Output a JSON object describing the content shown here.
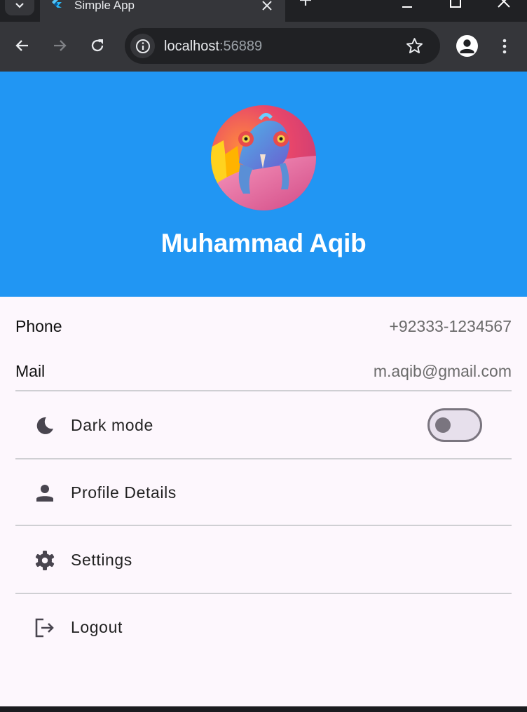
{
  "browser": {
    "tab_title": "Simple App",
    "url_host": "localhost",
    "url_port": ":56889"
  },
  "profile": {
    "name": "Muhammad Aqib"
  },
  "info": {
    "phone_label": "Phone",
    "phone_value": "+92333-1234567",
    "mail_label": "Mail",
    "mail_value": "m.aqib@gmail.com"
  },
  "menu": {
    "dark_mode_label": "Dark mode",
    "dark_mode_on": false,
    "profile_details_label": "Profile Details",
    "settings_label": "Settings",
    "logout_label": "Logout"
  },
  "colors": {
    "header": "#2196f3",
    "background": "#fdf7fd",
    "browser_dark": "#202124"
  },
  "icons": [
    "chevron-down-icon",
    "flutter-icon",
    "close-icon",
    "plus-icon",
    "minimize-icon",
    "maximize-icon",
    "back-arrow-icon",
    "forward-arrow-icon",
    "reload-icon",
    "info-icon",
    "star-icon",
    "account-icon",
    "more-vert-icon",
    "moon-icon",
    "person-icon",
    "gear-icon",
    "logout-icon"
  ]
}
